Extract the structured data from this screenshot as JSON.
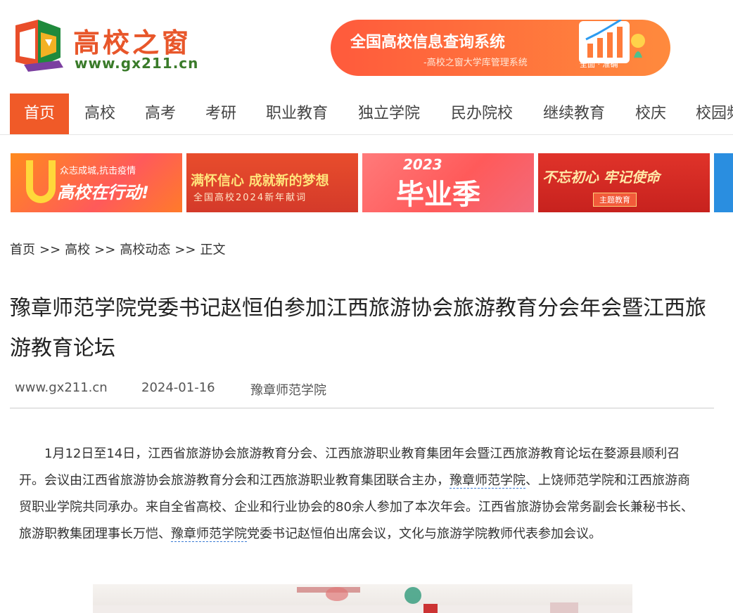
{
  "header": {
    "logo_title": "高校之窗",
    "logo_url": "www.gx211.cn",
    "banner_title": "全国高校信息查询系统",
    "banner_subtitle": "-高校之窗大学库管理系统",
    "banner_tag": "全面 · 准确"
  },
  "nav": {
    "items": [
      {
        "label": "首页",
        "active": true
      },
      {
        "label": "高校"
      },
      {
        "label": "高考"
      },
      {
        "label": "考研"
      },
      {
        "label": "职业教育"
      },
      {
        "label": "独立学院"
      },
      {
        "label": "民办院校"
      },
      {
        "label": "继续教育"
      },
      {
        "label": "校庆"
      },
      {
        "label": "校园频"
      }
    ]
  },
  "tiles": [
    {
      "line1": "众志成城,抗击疫情",
      "line2": "高校在行动!"
    },
    {
      "line1": "满怀信心 成就新的梦想",
      "line2": "全国高校2024新年献词"
    },
    {
      "line1": "2023",
      "line2": "毕业季"
    },
    {
      "line1": "不忘初心 牢记使命",
      "line2": "主题教育"
    }
  ],
  "breadcrumb": [
    "首页",
    ">>",
    "高校",
    ">>",
    "高校动态",
    ">>",
    "正文"
  ],
  "article": {
    "title_line1": "豫章师范学院党委书记赵恒伯参加江西旅游协会旅游教育分会年会暨江西旅",
    "title_line2": "游教育论坛",
    "source_site": "www.gx211.cn",
    "date": "2024-01-16",
    "author": "豫章师范学院",
    "p1_a": "1月12日至14日，江西省旅游协会旅游教育分会、江西旅游职业教育集团年会暨江西旅游教育论坛在婺源县顺利召开。会议由江西省旅游协会旅游教育分会和江西旅游职业教育集团联合主办，",
    "p1_link1": "豫章师范学院",
    "p1_b": "、上饶师范学院和江西旅游商贸职业学院共同承办。来自全省高校、企业和行业协会的80余人参加了本次年会。江西省旅游协会常务副会长兼秘书长、旅游职教集团理事长万恺、",
    "p1_link2": "豫章师范学院",
    "p1_c": "党委书记赵恒伯出席会议，文化与旅游学院教师代表参加会议。"
  },
  "colors": {
    "accent": "#f05a28",
    "link_underline": "#3b7bd4"
  }
}
